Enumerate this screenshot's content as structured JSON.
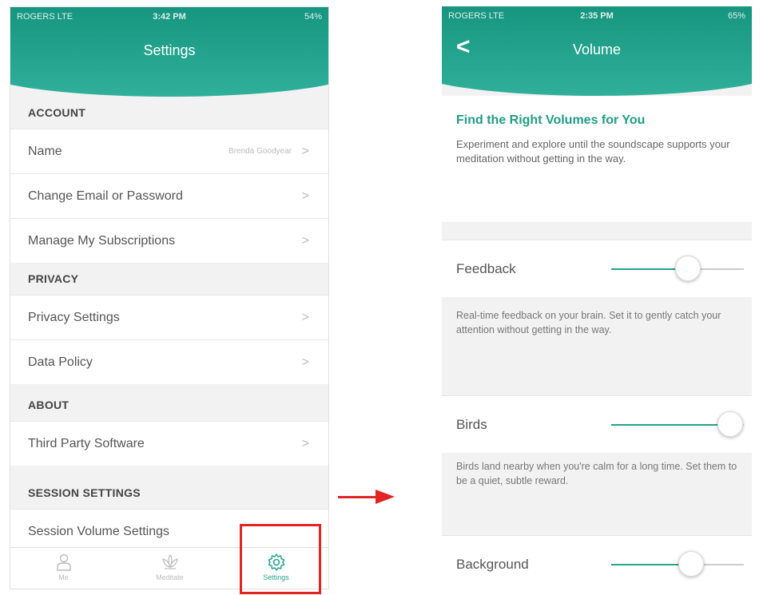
{
  "left": {
    "status": {
      "carrier": "ROGERS  LTE",
      "time": "3:42 PM",
      "battery": "54%"
    },
    "title": "Settings",
    "sections": [
      {
        "header": "ACCOUNT",
        "rows": [
          {
            "label": "Name",
            "value": "Brenda Goodyear"
          },
          {
            "label": "Change Email or Password"
          },
          {
            "label": "Manage My Subscriptions"
          }
        ]
      },
      {
        "header": "PRIVACY",
        "rows": [
          {
            "label": "Privacy Settings"
          },
          {
            "label": "Data Policy"
          }
        ]
      },
      {
        "header": "ABOUT",
        "rows": [
          {
            "label": "Third Party Software"
          }
        ]
      },
      {
        "header": "SESSION SETTINGS",
        "rows": [
          {
            "label": "Session Volume Settings"
          }
        ]
      }
    ],
    "chevron": ">",
    "tabs": [
      {
        "label": "Me",
        "icon": "person-icon"
      },
      {
        "label": "Meditate",
        "icon": "lotus-icon"
      },
      {
        "label": "Settings",
        "icon": "gear-icon",
        "active": true
      }
    ]
  },
  "right": {
    "status": {
      "carrier": "ROGERS  LTE",
      "time": "2:35 PM",
      "battery": "65%"
    },
    "title": "Volume",
    "back": "<",
    "intro_title": "Find the Right Volumes for You",
    "intro_text": "Experiment and explore until the soundscape supports your meditation without getting in the way.",
    "controls": [
      {
        "label": "Feedback",
        "level": 0.58,
        "desc": "Real-time feedback on your brain. Set it to gently catch your attention without getting in the way."
      },
      {
        "label": "Birds",
        "level": 0.9,
        "desc": "Birds land nearby when you're calm for a long time. Set them to be a quiet, subtle reward."
      },
      {
        "label": "Background",
        "level": 0.6,
        "desc": ""
      }
    ]
  },
  "colors": {
    "accent": "#1f9e86",
    "highlight": "#e22424"
  }
}
